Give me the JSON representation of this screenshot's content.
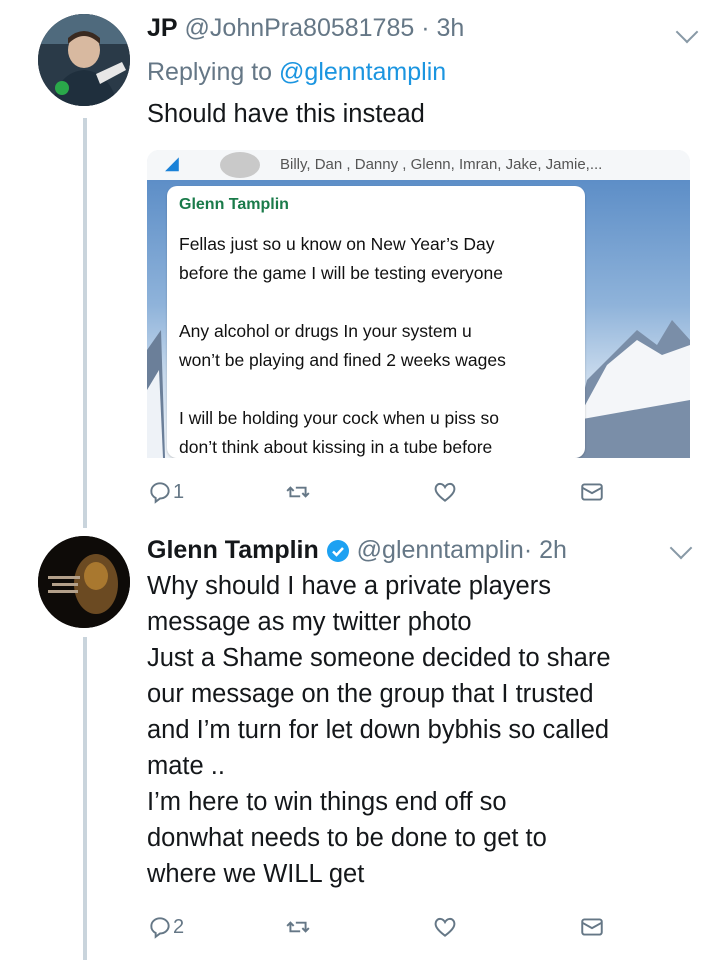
{
  "tweet1": {
    "name": "JP",
    "handle": "@JohnPra80581785",
    "time": "3h",
    "separator": " · ",
    "replying_prefix": "Replying to ",
    "replying_to": "@glenntamplin",
    "text": "Should have this instead",
    "embed": {
      "group_names": "Billy, Dan , Danny , Glenn, Imran, Jake, Jamie,...",
      "sender": "Glenn Tamplin",
      "message": "Fellas just so u know on New Year’s Day\nbefore the game I will be testing everyone\n\nAny alcohol or drugs In your system u\nwon’t be playing and fined 2 weeks wages\n\nI will be holding your cock when u piss so\ndon’t think about kissing in a tube before"
    },
    "actions": {
      "reply_count": "1",
      "retweet_count": "",
      "like_count": ""
    }
  },
  "tweet2": {
    "name": "Glenn Tamplin",
    "handle": "@glenntamplin",
    "time": "2h",
    "separator": "· ",
    "lines": [
      "Why should I have a private players",
      "message as my twitter photo",
      "Just a Shame someone decided to share",
      "our message on the group that I trusted",
      "and I’m turn for let down bybhis so called",
      "mate ..",
      "I’m here to win things end off so",
      "donwhat needs to be done to get to",
      "where we WILL get"
    ],
    "actions": {
      "reply_count": "2",
      "retweet_count": "",
      "like_count": ""
    }
  },
  "icons": {
    "reply": "reply-icon",
    "retweet": "retweet-icon",
    "like": "heart-icon",
    "dm": "envelope-icon",
    "more": "chevron-down-icon",
    "verified": "verified-badge-icon"
  },
  "colors": {
    "link": "#1b95e0",
    "secondary": "#657786",
    "verified": "#1da1f2",
    "thread": "#c9d4dc"
  }
}
